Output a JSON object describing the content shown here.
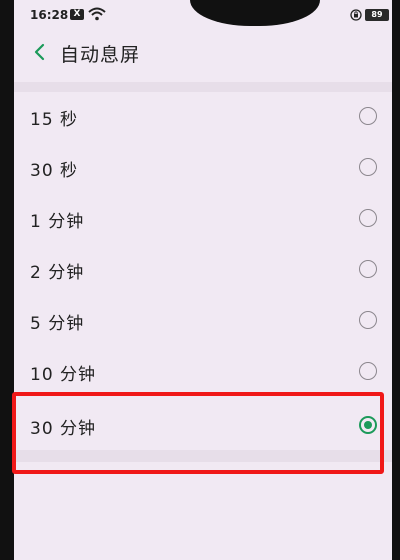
{
  "status_bar": {
    "time": "16:28",
    "x_badge": "X",
    "battery": "89"
  },
  "header": {
    "title": "自动息屏"
  },
  "options": [
    {
      "label": "15 秒",
      "selected": false
    },
    {
      "label": "30 秒",
      "selected": false
    },
    {
      "label": "1 分钟",
      "selected": false
    },
    {
      "label": "2 分钟",
      "selected": false
    },
    {
      "label": "5 分钟",
      "selected": false
    },
    {
      "label": "10 分钟",
      "selected": false
    },
    {
      "label": "30 分钟",
      "selected": true
    }
  ],
  "colors": {
    "background": "#f1e9f3",
    "accent": "#1c9a5a",
    "highlight": "#f01818"
  }
}
